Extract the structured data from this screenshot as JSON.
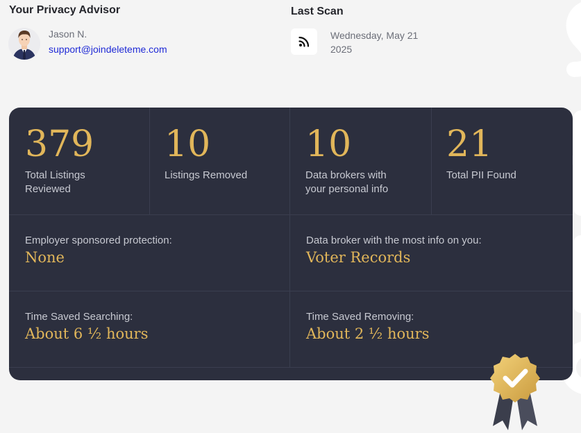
{
  "advisor": {
    "title": "Your Privacy Advisor",
    "name": "Jason N.",
    "email": "support@joindeleteme.com"
  },
  "scan": {
    "title": "Last Scan",
    "date_line1": "Wednesday, May 21",
    "date_line2": "2025",
    "icon": "rss-feed-icon"
  },
  "stats": [
    {
      "value": "379",
      "label": "Total Listings Reviewed"
    },
    {
      "value": "10",
      "label": "Listings Removed"
    },
    {
      "value": "10",
      "label": "Data brokers with your personal info"
    },
    {
      "value": "21",
      "label": "Total PII Found"
    }
  ],
  "info": {
    "employer_label": "Employer sponsored protection:",
    "employer_value": "None",
    "broker_label": "Data broker with the most info on you:",
    "broker_value": "Voter Records",
    "searching_label": "Time Saved Searching:",
    "searching_value": "About 6 ½ hours",
    "removing_label": "Time Saved Removing:",
    "removing_value": "About 2 ½ hours"
  },
  "colors": {
    "card_bg": "#2c2f3e",
    "accent_gold": "#e1b65a",
    "email_link": "#1f2ad6",
    "page_bg": "#f4f4f4"
  },
  "icons": [
    "rss-feed-icon",
    "award-badge-icon",
    "advisor-avatar"
  ]
}
